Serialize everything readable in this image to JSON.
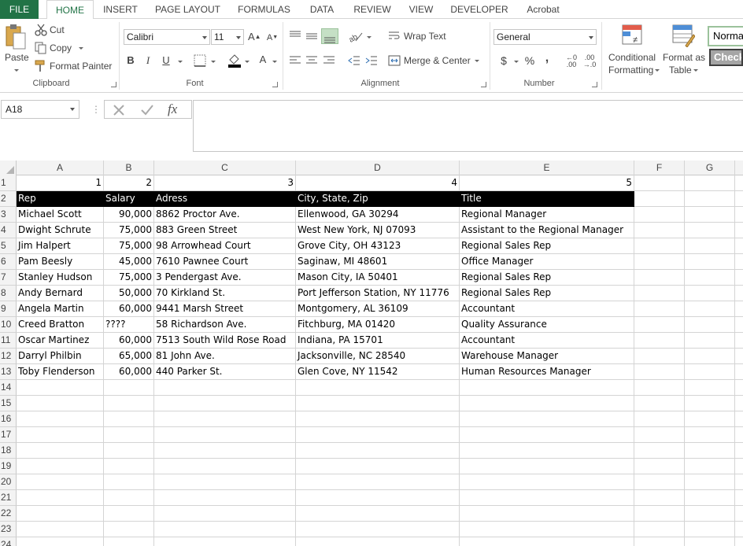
{
  "tabs": [
    "FILE",
    "HOME",
    "INSERT",
    "PAGE LAYOUT",
    "FORMULAS",
    "DATA",
    "REVIEW",
    "VIEW",
    "DEVELOPER",
    "Acrobat"
  ],
  "clipboard": {
    "paste": "Paste",
    "cut": "Cut",
    "copy": "Copy",
    "format_painter": "Format Painter",
    "group": "Clipboard"
  },
  "font": {
    "name": "Calibri",
    "size": "11",
    "bold": "B",
    "italic": "I",
    "underline": "U",
    "group": "Font"
  },
  "alignment": {
    "wrap_text": "Wrap Text",
    "merge_center": "Merge & Center",
    "group": "Alignment"
  },
  "number": {
    "format": "General",
    "currency": "$",
    "percent": "%",
    "comma": ",",
    "group": "Number"
  },
  "styles": {
    "conditional_1": "Conditional",
    "conditional_2": "Formatting",
    "format_table_1": "Format as",
    "format_table_2": "Table",
    "normal": "Norma",
    "check": "Check"
  },
  "formula_bar": {
    "name_box": "A18",
    "fx": "fx",
    "value": ""
  },
  "colors": {
    "accent": "#217346",
    "header_row_bg": "#000000",
    "header_row_fg": "#ffffff"
  },
  "sheet": {
    "columns": [
      "A",
      "B",
      "C",
      "D",
      "E",
      "F",
      "G"
    ],
    "rows": [
      {
        "n": "1",
        "cells": [
          "1",
          "2",
          "3",
          "4",
          "5",
          "",
          ""
        ]
      },
      {
        "n": "2",
        "cells": [
          "Rep",
          "Salary",
          "Adress",
          "City, State, Zip",
          "Title",
          "",
          ""
        ]
      },
      {
        "n": "3",
        "cells": [
          "Michael Scott",
          "90,000",
          "8862 Proctor Ave.",
          "Ellenwood, GA 30294",
          "Regional Manager",
          "",
          ""
        ]
      },
      {
        "n": "4",
        "cells": [
          "Dwight Schrute",
          "75,000",
          "883 Green Street",
          "West New York, NJ 07093",
          "Assistant to the Regional Manager",
          "",
          ""
        ]
      },
      {
        "n": "5",
        "cells": [
          "Jim Halpert",
          "75,000",
          "98 Arrowhead Court",
          "Grove City, OH 43123",
          "Regional Sales Rep",
          "",
          ""
        ]
      },
      {
        "n": "6",
        "cells": [
          "Pam Beesly",
          "45,000",
          "7610 Pawnee Court",
          "Saginaw, MI 48601",
          "Office Manager",
          "",
          ""
        ]
      },
      {
        "n": "7",
        "cells": [
          "Stanley Hudson",
          "75,000",
          "3 Pendergast Ave.",
          "Mason City, IA 50401",
          "Regional Sales Rep",
          "",
          ""
        ]
      },
      {
        "n": "8",
        "cells": [
          "Andy Bernard",
          "50,000",
          "70 Kirkland St.",
          "Port Jefferson Station, NY 11776",
          "Regional Sales Rep",
          "",
          ""
        ]
      },
      {
        "n": "9",
        "cells": [
          "Angela Martin",
          "60,000",
          "9441 Marsh Street",
          "Montgomery, AL 36109",
          "Accountant",
          "",
          ""
        ]
      },
      {
        "n": "10",
        "cells": [
          "Creed Bratton",
          "????",
          "58 Richardson Ave.",
          "Fitchburg, MA 01420",
          "Quality Assurance",
          "",
          ""
        ]
      },
      {
        "n": "11",
        "cells": [
          "Oscar Martinez",
          "60,000",
          "7513 South Wild Rose Road",
          "Indiana, PA 15701",
          "Accountant",
          "",
          ""
        ]
      },
      {
        "n": "12",
        "cells": [
          "Darryl Philbin",
          "65,000",
          "81 John Ave.",
          "Jacksonville, NC 28540",
          "Warehouse Manager",
          "",
          ""
        ]
      },
      {
        "n": "13",
        "cells": [
          "Toby Flenderson",
          "60,000",
          "440 Parker St.",
          "Glen Cove, NY 11542",
          "Human Resources Manager",
          "",
          ""
        ]
      },
      {
        "n": "14",
        "cells": [
          "",
          "",
          "",
          "",
          "",
          "",
          ""
        ]
      },
      {
        "n": "15",
        "cells": [
          "",
          "",
          "",
          "",
          "",
          "",
          ""
        ]
      },
      {
        "n": "16",
        "cells": [
          "",
          "",
          "",
          "",
          "",
          "",
          ""
        ]
      },
      {
        "n": "17",
        "cells": [
          "",
          "",
          "",
          "",
          "",
          "",
          ""
        ]
      },
      {
        "n": "18",
        "cells": [
          "",
          "",
          "",
          "",
          "",
          "",
          ""
        ]
      },
      {
        "n": "19",
        "cells": [
          "",
          "",
          "",
          "",
          "",
          "",
          ""
        ]
      },
      {
        "n": "20",
        "cells": [
          "",
          "",
          "",
          "",
          "",
          "",
          ""
        ]
      },
      {
        "n": "21",
        "cells": [
          "",
          "",
          "",
          "",
          "",
          "",
          ""
        ]
      },
      {
        "n": "22",
        "cells": [
          "",
          "",
          "",
          "",
          "",
          "",
          ""
        ]
      },
      {
        "n": "23",
        "cells": [
          "",
          "",
          "",
          "",
          "",
          "",
          ""
        ]
      },
      {
        "n": "24",
        "cells": [
          "",
          "",
          "",
          "",
          "",
          "",
          ""
        ]
      }
    ]
  }
}
